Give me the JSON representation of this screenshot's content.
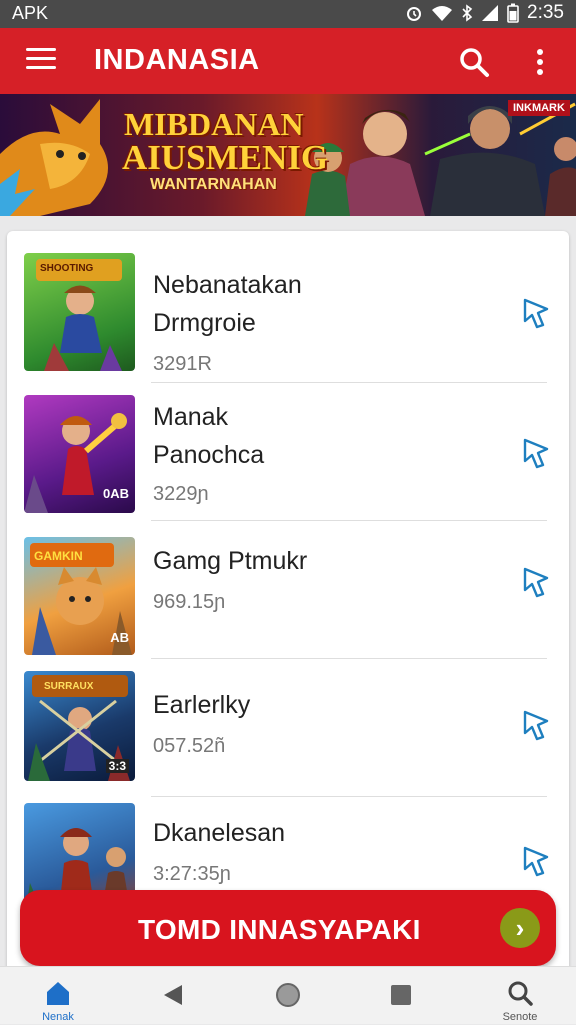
{
  "status_bar": {
    "left_text": "APK",
    "time": "2:35"
  },
  "app_bar": {
    "title": "INDANASIA",
    "menu_icon": "hamburger-menu-icon",
    "search_icon": "search-icon",
    "more_icon": "more-vert-icon"
  },
  "banner": {
    "line1": "MIBDANAN",
    "line2": "AIUSMENIG",
    "subtitle": "WANTARNAHAN",
    "badge": "INKMARK"
  },
  "apps": [
    {
      "name_line1": "Nebanatakan",
      "name_line2": "Drmgroie",
      "size": "3291R",
      "bookmark_icon": "bookmark-icon"
    },
    {
      "name_line1": "Manak",
      "name_line2": "Panochca",
      "size": "3229ɲ",
      "bookmark_icon": "bookmark-icon"
    },
    {
      "name_line1": "Gamg Ptmukr",
      "name_line2": "",
      "size": "969.15ɲ",
      "bookmark_icon": "bookmark-icon"
    },
    {
      "name_line1": "Earlerlky",
      "name_line2": "",
      "size": "057.52ñ",
      "bookmark_icon": "bookmark-icon"
    },
    {
      "name_line1": "Dkanelesan",
      "name_line2": "",
      "size": "3:27:35ɲ",
      "bookmark_icon": "bookmark-icon"
    }
  ],
  "thumb_labels": [
    "SHOOTING",
    "",
    "GAMKIN",
    "SURRAUX",
    ""
  ],
  "thumb_corner_labels": [
    "",
    "0AB",
    "AB",
    "3:3",
    ""
  ],
  "cta": {
    "label": "TOMD INNASYAPAKI"
  },
  "nav": {
    "home_label": "Nenak",
    "search_label": "Senote"
  },
  "colors": {
    "primary": "#d62027",
    "bookmark": "#1e7fbf",
    "cta_arrow": "#8a9a18"
  }
}
